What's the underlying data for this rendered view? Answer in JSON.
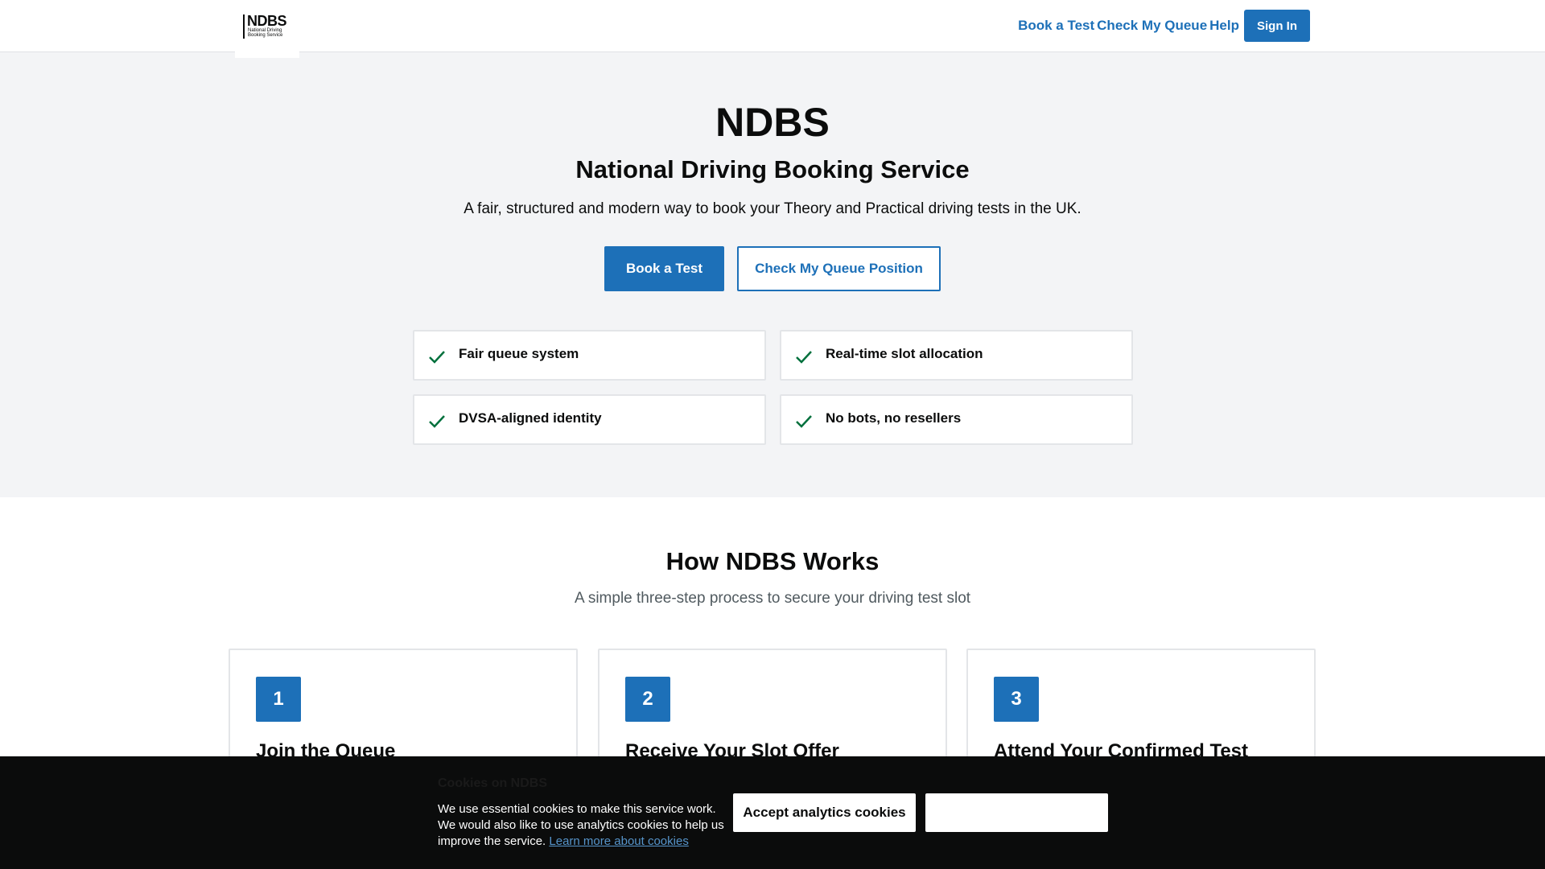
{
  "header": {
    "logo": {
      "main": "NDBS",
      "sub": "National Driving Booking Service"
    },
    "nav": {
      "book_test": "Book a Test",
      "check_queue": "Check My Queue",
      "help": "Help",
      "sign_in": "Sign In"
    }
  },
  "hero": {
    "title": "NDBS",
    "subtitle": "National Driving Booking Service",
    "description": "A fair, structured and modern way to book your Theory and Practical driving tests in the UK.",
    "primary_button": "Book a Test",
    "secondary_button": "Check My Queue Position",
    "features": [
      {
        "label": "Fair queue system",
        "icon": "check-icon"
      },
      {
        "label": "Real-time slot allocation",
        "icon": "check-icon"
      },
      {
        "label": "DVSA-aligned identity",
        "icon": "check-icon"
      },
      {
        "label": "No bots, no resellers",
        "icon": "check-icon"
      }
    ]
  },
  "how": {
    "title": "How NDBS Works",
    "subtitle": "A simple three-step process to secure your driving test slot",
    "steps": [
      {
        "number": "1",
        "title": "Join the Queue"
      },
      {
        "number": "2",
        "title": "Receive Your Slot Offer"
      },
      {
        "number": "3",
        "title": "Attend Your Confirmed Test"
      }
    ]
  },
  "cookie_banner": {
    "title": "Cookies on NDBS",
    "text": "We use essential cookies to make this service work. We would also like to use analytics cookies to help us improve the service.",
    "link_text": "Learn more about cookies",
    "accept_button": "Accept analytics cookies",
    "reject_button": ""
  },
  "colors": {
    "primary": "#1d70b8",
    "hero_background": "#f3f4f6",
    "check": "#00703c",
    "cookie_background": "#0b0c0c",
    "link_on_dark": "#5694ca"
  }
}
